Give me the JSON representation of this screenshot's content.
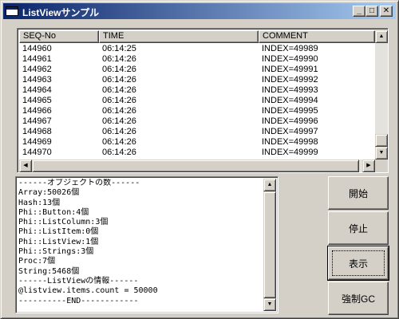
{
  "window": {
    "title": "ListViewサンプル",
    "caption_buttons": {
      "minimize": "_",
      "maximize": "□",
      "close": "✕"
    }
  },
  "listview": {
    "columns": [
      "SEQ-No",
      "TIME",
      "COMMENT"
    ],
    "rows": [
      [
        "144960",
        "06:14:25",
        "INDEX=49989"
      ],
      [
        "144961",
        "06:14:26",
        "INDEX=49990"
      ],
      [
        "144962",
        "06:14:26",
        "INDEX=49991"
      ],
      [
        "144963",
        "06:14:26",
        "INDEX=49992"
      ],
      [
        "144964",
        "06:14:26",
        "INDEX=49993"
      ],
      [
        "144965",
        "06:14:26",
        "INDEX=49994"
      ],
      [
        "144966",
        "06:14:26",
        "INDEX=49995"
      ],
      [
        "144967",
        "06:14:26",
        "INDEX=49996"
      ],
      [
        "144968",
        "06:14:26",
        "INDEX=49997"
      ],
      [
        "144969",
        "06:14:26",
        "INDEX=49998"
      ],
      [
        "144970",
        "06:14:26",
        "INDEX=49999"
      ]
    ]
  },
  "output": {
    "lines": [
      "------オブジェクトの数------",
      "Array:50026個",
      "Hash:13個",
      "Phi::Button:4個",
      "Phi::ListColumn:3個",
      "Phi::ListItem:0個",
      "Phi::ListView:1個",
      "Phi::Strings:3個",
      "Proc:7個",
      "String:5468個",
      "------ListViewの情報------",
      "@listview.items.count = 50000",
      "----------END------------"
    ]
  },
  "buttons": {
    "start": "開始",
    "stop": "停止",
    "show": "表示",
    "gc": "強制GC"
  },
  "scroll_arrows": {
    "up": "▲",
    "down": "▼",
    "left": "◀",
    "right": "▶"
  }
}
